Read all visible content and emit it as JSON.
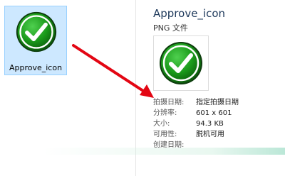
{
  "file": {
    "name": "Approve_icon",
    "icon": "green-checkmark-icon"
  },
  "details": {
    "title": "Approve_icon",
    "type": "PNG 文件",
    "properties": [
      {
        "label": "拍摄日期:",
        "value": "指定拍摄日期"
      },
      {
        "label": "分辨率:",
        "value": "601 x 601"
      },
      {
        "label": "大小:",
        "value": "94.3 KB"
      },
      {
        "label": "可用性:",
        "value": "脱机可用"
      },
      {
        "label": "创建日期:",
        "value": ""
      }
    ]
  },
  "annotation": {
    "arrow_color": "#e30613"
  },
  "colors": {
    "check_green": "#1a9a1a",
    "tile_selected": "#cde8ff"
  }
}
